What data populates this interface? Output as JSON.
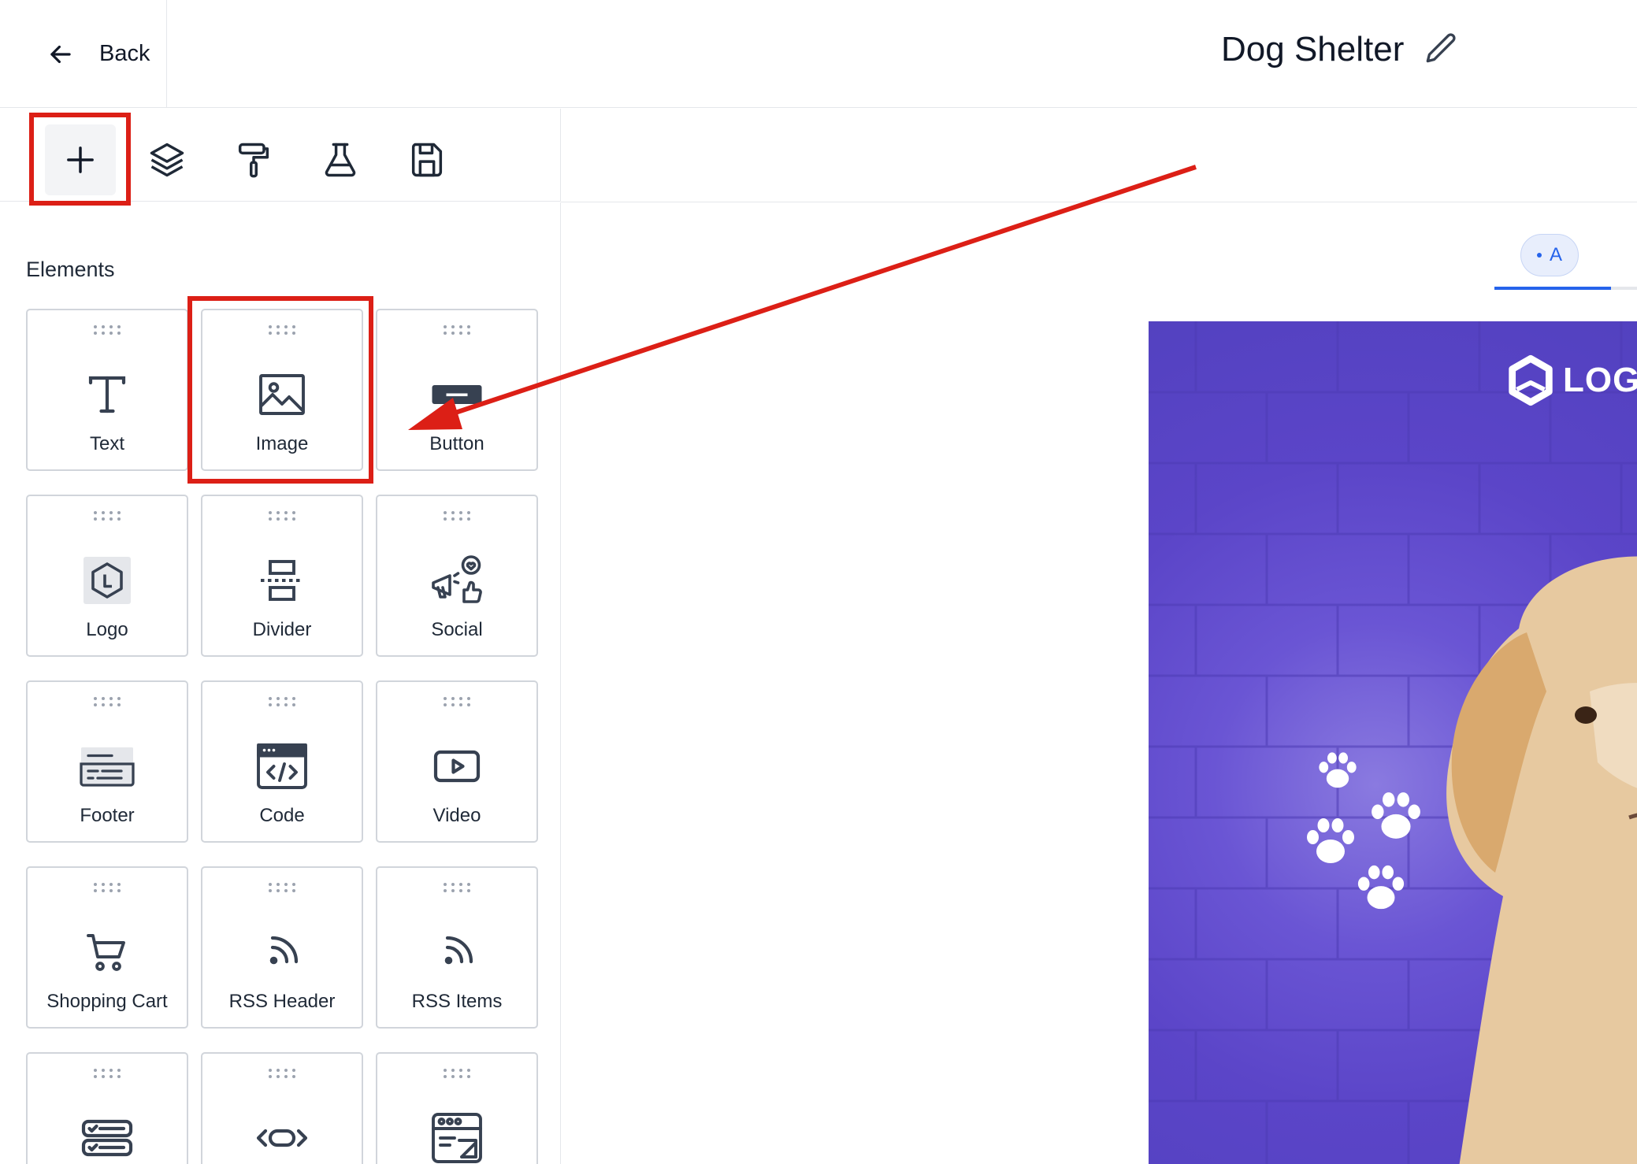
{
  "header": {
    "back_label": "Back",
    "title": "Dog Shelter"
  },
  "toolbar": {
    "items": [
      {
        "name": "add",
        "icon": "plus-icon",
        "active": true
      },
      {
        "name": "layers",
        "icon": "layers-icon"
      },
      {
        "name": "styles",
        "icon": "paint-roller-icon"
      },
      {
        "name": "test",
        "icon": "flask-icon"
      },
      {
        "name": "save",
        "icon": "save-icon"
      }
    ]
  },
  "sidebar": {
    "section_title": "Elements",
    "elements": [
      {
        "label": "Text",
        "icon": "text-icon"
      },
      {
        "label": "Image",
        "icon": "image-icon"
      },
      {
        "label": "Button",
        "icon": "button-icon"
      },
      {
        "label": "Logo",
        "icon": "logo-icon"
      },
      {
        "label": "Divider",
        "icon": "divider-icon"
      },
      {
        "label": "Social",
        "icon": "social-icon"
      },
      {
        "label": "Footer",
        "icon": "footer-icon"
      },
      {
        "label": "Code",
        "icon": "code-icon"
      },
      {
        "label": "Video",
        "icon": "video-icon"
      },
      {
        "label": "Shopping Cart",
        "icon": "cart-icon"
      },
      {
        "label": "RSS Header",
        "icon": "rss-icon"
      },
      {
        "label": "RSS Items",
        "icon": "rss-icon"
      },
      {
        "label": "",
        "icon": "list-items-icon"
      },
      {
        "label": "",
        "icon": "component-icon"
      },
      {
        "label": "",
        "icon": "webpage-link-icon"
      }
    ]
  },
  "canvas": {
    "variant_label": "A",
    "banner": {
      "logo_text": "LOGO",
      "background_color": "#5b45c8"
    }
  },
  "annotation": {
    "color": "#dc1f16"
  }
}
